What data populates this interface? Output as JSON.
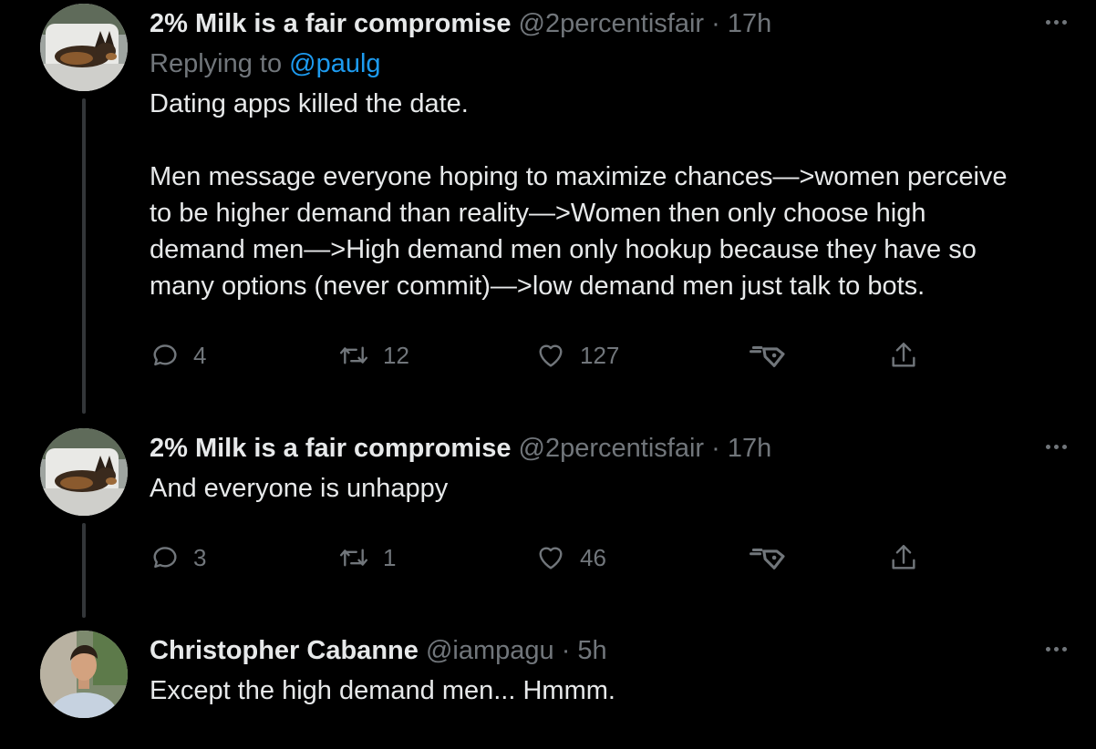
{
  "tweets": [
    {
      "name": "2% Milk is a fair compromise",
      "handle": "@2percentisfair",
      "separator": "·",
      "time": "17h",
      "replying_prefix": "Replying to",
      "replying_handle": "@paulg",
      "text_lines": [
        "Dating apps killed the date.",
        "Men message everyone hoping to maximize chances—>women perceive",
        "to be higher demand than reality—>Women then only choose high",
        "demand men—>High demand men only hookup because they have so",
        "many options (never commit)—>low demand men just talk to bots."
      ],
      "replies": "4",
      "retweets": "12",
      "likes": "127"
    },
    {
      "name": "2% Milk is a fair compromise",
      "handle": "@2percentisfair",
      "separator": "·",
      "time": "17h",
      "text_lines": [
        "And everyone is unhappy"
      ],
      "replies": "3",
      "retweets": "1",
      "likes": "46"
    },
    {
      "name": "Christopher Cabanne",
      "handle": "@iampagu",
      "separator": "·",
      "time": "5h",
      "text_lines": [
        "Except the high demand men... Hmmm."
      ]
    }
  ],
  "icons": {
    "reply": "reply-icon",
    "retweet": "retweet-icon",
    "like": "heart-icon",
    "tip": "tip-jar-icon",
    "share": "share-icon",
    "more": "more-options-icon"
  },
  "colors": {
    "background": "#000000",
    "text": "#e7e9ea",
    "secondary": "#71767b",
    "link": "#1d9bf0",
    "thread_line": "#333639"
  }
}
